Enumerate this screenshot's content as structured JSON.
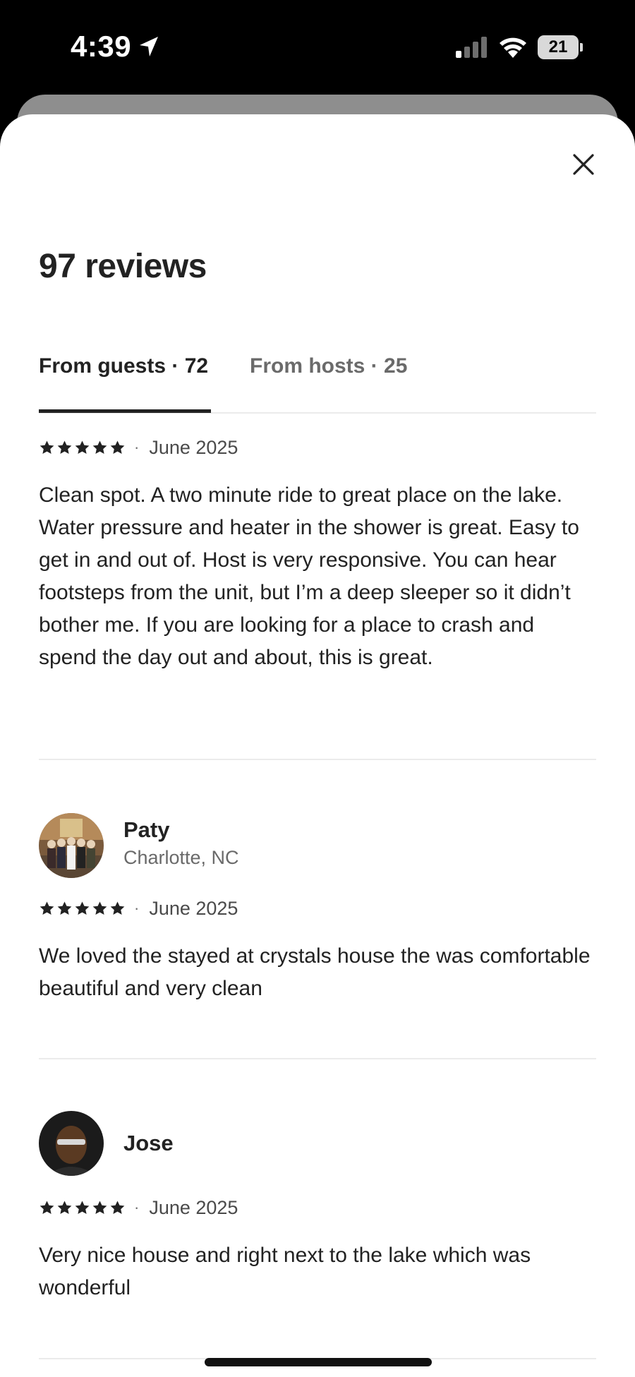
{
  "status_bar": {
    "time": "4:39",
    "battery": "21",
    "icons": [
      "location-arrow-icon",
      "cellular-signal-icon",
      "wifi-icon",
      "battery-icon"
    ]
  },
  "modal": {
    "title": "97 reviews",
    "close_icon": "close-icon",
    "tabs": [
      {
        "label": "From guests · 72",
        "active": true
      },
      {
        "label": "From hosts · 25",
        "active": false
      }
    ]
  },
  "reviews": [
    {
      "rating": 5,
      "date": "June 2025",
      "text": "Clean spot. A two minute ride to great place on the lake. Water pressure and heater in the shower is great. Easy to get in and out of. Host is very responsive. You can hear footsteps from the unit, but I’m a deep sleeper so it didn’t bother me. If you are looking for a place to crash and spend the day out and about, this is great."
    },
    {
      "name": "Paty",
      "location": "Charlotte, NC",
      "rating": 5,
      "date": "June 2025",
      "text": "We loved the stayed at crystals house the was comfortable beautiful and very clean"
    },
    {
      "name": "Jose",
      "rating": 5,
      "date": "June 2025",
      "text": "Very nice house and right next to the lake which was wonderful"
    }
  ],
  "separator": "·",
  "colors": {
    "text_primary": "#222222",
    "text_secondary": "#6a6a6a",
    "divider": "#ebebeb",
    "sheet_bg": "#ffffff",
    "status_bg": "#000000"
  }
}
